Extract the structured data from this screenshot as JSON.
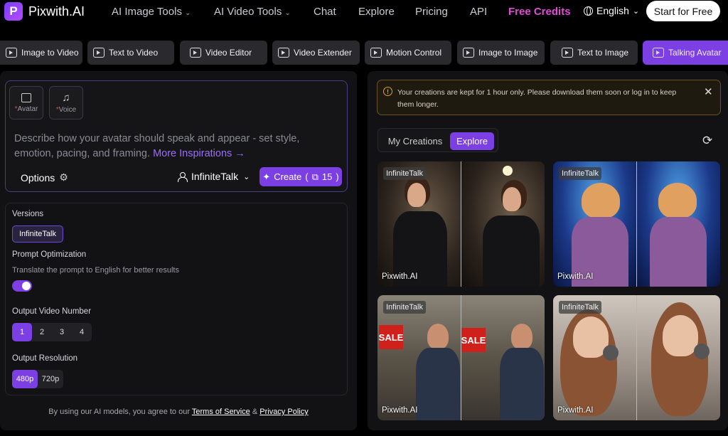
{
  "app": {
    "name": "Pixwith.AI",
    "logo_letter": "P"
  },
  "nav": {
    "items": [
      {
        "label": "AI Image Tools",
        "dropdown": true
      },
      {
        "label": "AI Video Tools",
        "dropdown": true
      },
      {
        "label": "Chat",
        "dropdown": false
      },
      {
        "label": "Explore",
        "dropdown": false
      },
      {
        "label": "Pricing",
        "dropdown": false
      },
      {
        "label": "API",
        "dropdown": false
      }
    ],
    "free_credits": "Free Credits",
    "language": "English",
    "start_button": "Start for Free"
  },
  "tools": [
    {
      "label": "Image to Video",
      "icon": "image-video-icon",
      "active": false
    },
    {
      "label": "Text to Video",
      "icon": "text-video-icon",
      "active": false
    },
    {
      "label": "Video Editor",
      "icon": "video-editor-icon",
      "active": false
    },
    {
      "label": "Video Extender",
      "icon": "video-extender-icon",
      "active": false
    },
    {
      "label": "Motion Control",
      "icon": "motion-control-icon",
      "active": false
    },
    {
      "label": "Image to Image",
      "icon": "image-image-icon",
      "active": false
    },
    {
      "label": "Text to Image",
      "icon": "text-image-icon",
      "active": false
    },
    {
      "label": "Talking Avatar",
      "icon": "talking-avatar-icon",
      "active": true
    }
  ],
  "prompt": {
    "avatar_label": "Avatar",
    "voice_label": "Voice",
    "required_mark": "*",
    "placeholder": "Describe how your avatar should speak and appear - set style, emotion, pacing, and framing.",
    "more_link": "More Inspirations →",
    "options_label": "Options",
    "model": "InfiniteTalk",
    "create_label": "Create",
    "create_cost": "15"
  },
  "settings": {
    "versions_label": "Versions",
    "version_value": "InfiniteTalk",
    "prompt_opt_label": "Prompt Optimization",
    "prompt_opt_desc": "Translate the prompt to English for better results",
    "prompt_opt_enabled": true,
    "output_number_label": "Output Video Number",
    "output_numbers": [
      "1",
      "2",
      "3",
      "4"
    ],
    "output_number_selected": "1",
    "resolution_label": "Output Resolution",
    "resolutions": [
      "480p",
      "720p"
    ],
    "resolution_selected": "480p"
  },
  "legal": {
    "prefix": "By using our AI models, you agree to our ",
    "tos": "Terms of Service",
    "amp": " & ",
    "privacy": "Privacy Policy"
  },
  "notice": {
    "text": "Your creations are kept for 1 hour only. Please download them soon or log in to keep them longer."
  },
  "gallery": {
    "tabs": [
      "My Creations",
      "Explore"
    ],
    "active_tab": "Explore",
    "cards": [
      {
        "tag": "InfiniteTalk",
        "watermark": "Pixwith.AI"
      },
      {
        "tag": "InfiniteTalk",
        "watermark": "Pixwith.AI"
      },
      {
        "tag": "InfiniteTalk",
        "watermark": "Pixwith.AI"
      },
      {
        "tag": "InfiniteTalk",
        "watermark": "Pixwith.AI"
      }
    ],
    "sale_sign": "SALE"
  },
  "colors": {
    "accent": "#7b3fe4",
    "free_credits": "#e24bd7",
    "warning": "#e0a12a"
  }
}
